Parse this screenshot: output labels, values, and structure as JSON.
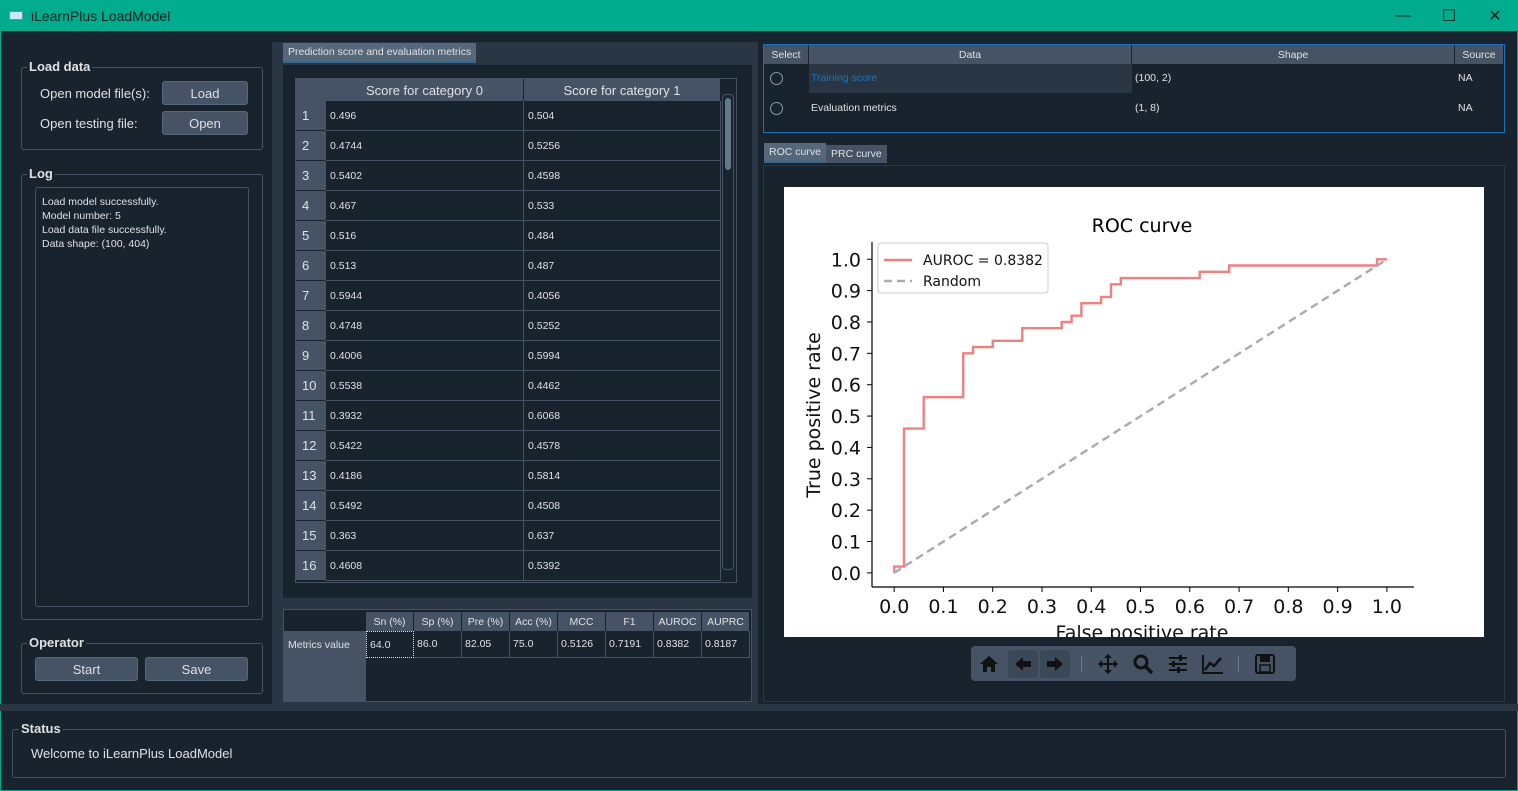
{
  "window": {
    "title": "iLearnPlus LoadModel",
    "minimize": "—",
    "maximize": "☐",
    "close": "✕"
  },
  "load_data": {
    "title": "Load data",
    "model_label": "Open model file(s):",
    "load_button": "Load",
    "testing_label": "Open testing file:",
    "open_button": "Open"
  },
  "log": {
    "title": "Log",
    "lines": [
      "Load model successfully.",
      "Model number: 5",
      "Load data file successfully.",
      "Data shape: (100, 404)"
    ]
  },
  "operator": {
    "title": "Operator",
    "start_button": "Start",
    "save_button": "Save"
  },
  "score_tab": {
    "label": "Prediction score and evaluation metrics"
  },
  "score_table": {
    "headers": [
      "Score for category 0",
      "Score for category 1"
    ],
    "rows": [
      {
        "n": "1",
        "c0": "0.496",
        "c1": "0.504"
      },
      {
        "n": "2",
        "c0": "0.4744",
        "c1": "0.5256"
      },
      {
        "n": "3",
        "c0": "0.5402",
        "c1": "0.4598"
      },
      {
        "n": "4",
        "c0": "0.467",
        "c1": "0.533"
      },
      {
        "n": "5",
        "c0": "0.516",
        "c1": "0.484"
      },
      {
        "n": "6",
        "c0": "0.513",
        "c1": "0.487"
      },
      {
        "n": "7",
        "c0": "0.5944",
        "c1": "0.4056"
      },
      {
        "n": "8",
        "c0": "0.4748",
        "c1": "0.5252"
      },
      {
        "n": "9",
        "c0": "0.4006",
        "c1": "0.5994"
      },
      {
        "n": "10",
        "c0": "0.5538",
        "c1": "0.4462"
      },
      {
        "n": "11",
        "c0": "0.3932",
        "c1": "0.6068"
      },
      {
        "n": "12",
        "c0": "0.5422",
        "c1": "0.4578"
      },
      {
        "n": "13",
        "c0": "0.4186",
        "c1": "0.5814"
      },
      {
        "n": "14",
        "c0": "0.5492",
        "c1": "0.4508"
      },
      {
        "n": "15",
        "c0": "0.363",
        "c1": "0.637"
      },
      {
        "n": "16",
        "c0": "0.4608",
        "c1": "0.5392"
      }
    ]
  },
  "metrics_table": {
    "row_label": "Metrics value",
    "headers": [
      "Sn (%)",
      "Sp (%)",
      "Pre (%)",
      "Acc (%)",
      "MCC",
      "F1",
      "AUROC",
      "AUPRC"
    ],
    "values": [
      "64.0",
      "86.0",
      "82.05",
      "75.0",
      "0.5126",
      "0.7191",
      "0.8382",
      "0.8187"
    ]
  },
  "data_table": {
    "headers": [
      "Select",
      "Data",
      "Shape",
      "Source"
    ],
    "rows": [
      {
        "data": "Training score",
        "shape": "(100, 2)",
        "source": "NA"
      },
      {
        "data": "Evaluation metrics",
        "shape": "(1, 8)",
        "source": "NA"
      }
    ]
  },
  "plot_tabs": [
    "ROC curve",
    "PRC curve"
  ],
  "toolbar_icons": [
    "home-icon",
    "back-arrow-icon",
    "forward-arrow-icon",
    "pan-move-icon",
    "zoom-icon",
    "configure-subplots-icon",
    "edit-axis-icon",
    "save-figure-icon"
  ],
  "status": {
    "title": "Status",
    "message": "Welcome to iLearnPlus LoadModel"
  },
  "colors": {
    "accent": "#00ab8e",
    "roc_line": "#f08080",
    "random_line": "#aaaaaa",
    "link": "#1a72bb"
  },
  "chart_data": {
    "type": "line",
    "title": "ROC curve",
    "xlabel": "False positive rate",
    "ylabel": "True positive rate",
    "xlim": [
      0.0,
      1.0
    ],
    "ylim": [
      0.0,
      1.0
    ],
    "xticks": [
      "0.0",
      "0.1",
      "0.2",
      "0.3",
      "0.4",
      "0.5",
      "0.6",
      "0.7",
      "0.8",
      "0.9",
      "1.0"
    ],
    "yticks": [
      "0.0",
      "0.1",
      "0.2",
      "0.3",
      "0.4",
      "0.5",
      "0.6",
      "0.7",
      "0.8",
      "0.9",
      "1.0"
    ],
    "legend_position": "top-left",
    "series": [
      {
        "name": "AUROC = 0.8382",
        "style": "solid",
        "x": [
          0.0,
          0.0,
          0.02,
          0.02,
          0.06,
          0.06,
          0.14,
          0.14,
          0.16,
          0.16,
          0.2,
          0.2,
          0.26,
          0.26,
          0.34,
          0.34,
          0.36,
          0.36,
          0.38,
          0.38,
          0.42,
          0.42,
          0.44,
          0.44,
          0.46,
          0.46,
          0.62,
          0.62,
          0.68,
          0.68,
          0.98,
          0.98,
          1.0
        ],
        "y": [
          0.0,
          0.02,
          0.02,
          0.46,
          0.46,
          0.56,
          0.56,
          0.7,
          0.7,
          0.72,
          0.72,
          0.74,
          0.74,
          0.78,
          0.78,
          0.8,
          0.8,
          0.82,
          0.82,
          0.86,
          0.86,
          0.88,
          0.88,
          0.92,
          0.92,
          0.94,
          0.94,
          0.96,
          0.96,
          0.98,
          0.98,
          1.0,
          1.0
        ]
      },
      {
        "name": "Random",
        "style": "dashed",
        "x": [
          0.0,
          1.0
        ],
        "y": [
          0.0,
          1.0
        ]
      }
    ]
  }
}
